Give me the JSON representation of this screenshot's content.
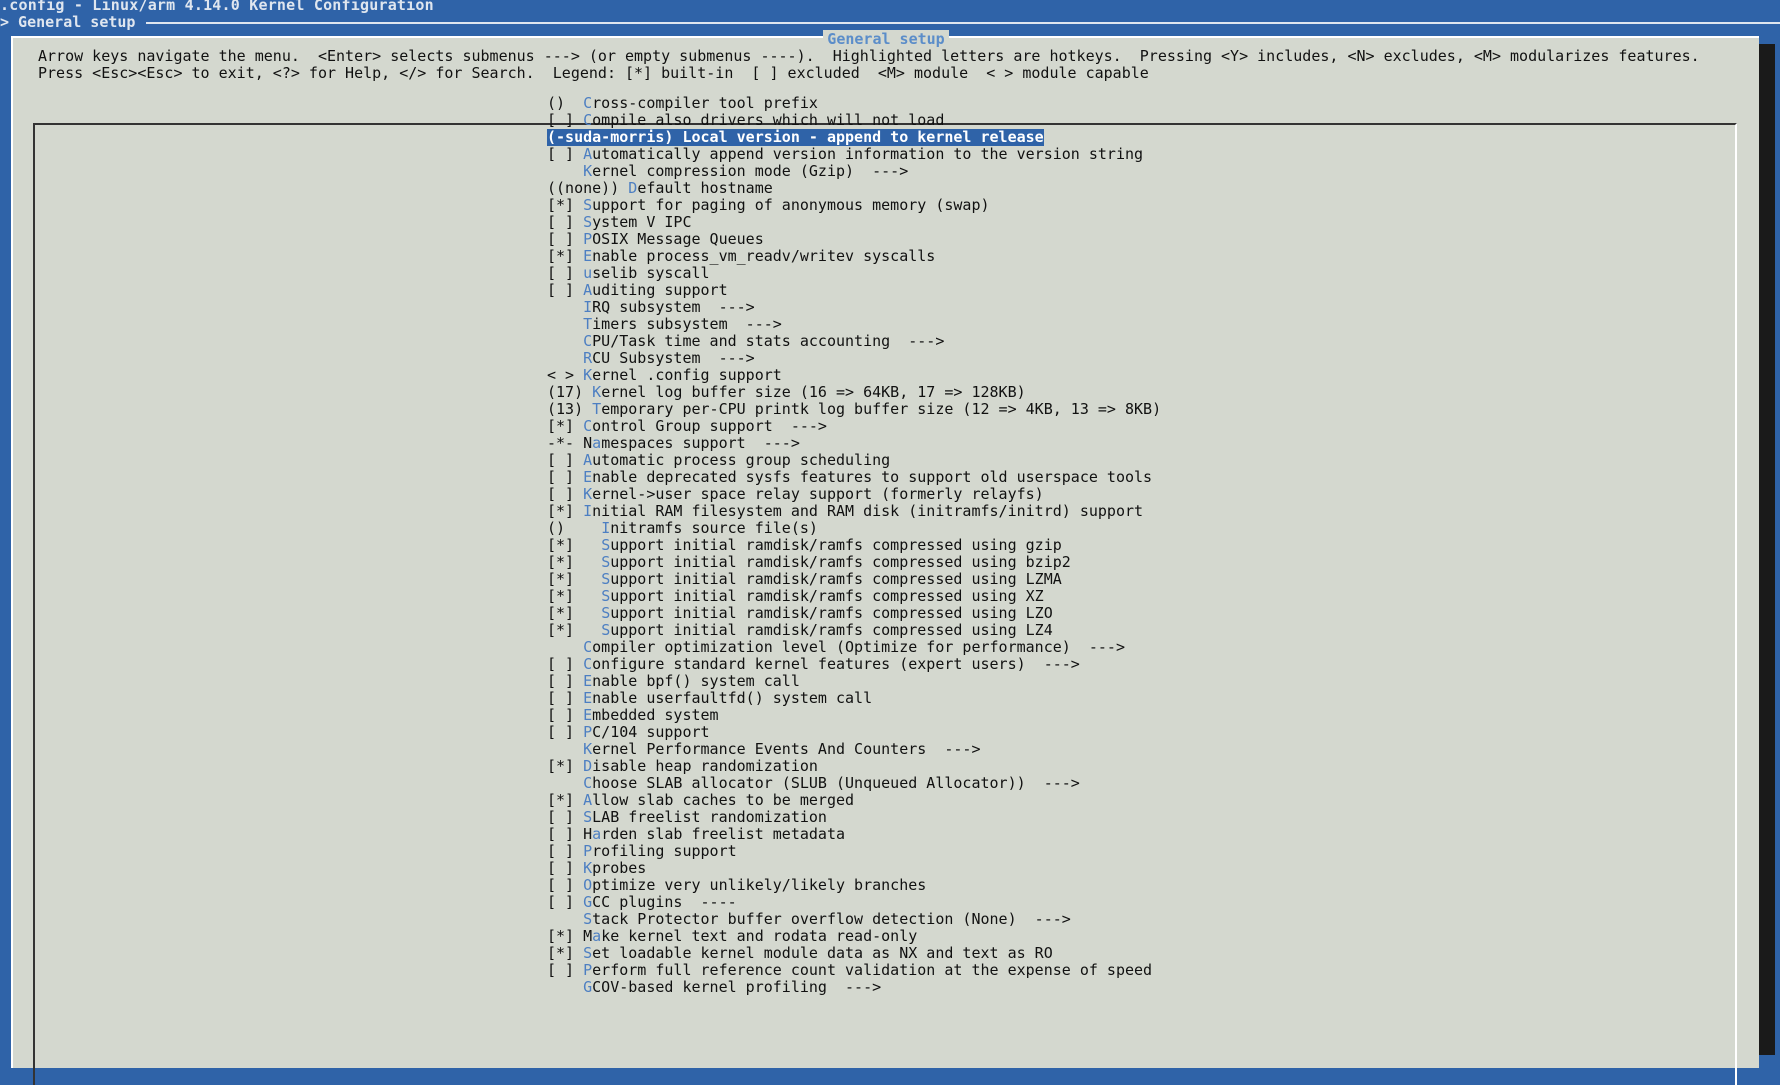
{
  "window": {
    "title": ".config - Linux/arm 4.14.0 Kernel Configuration",
    "breadcrumb": "> General setup"
  },
  "colors": {
    "background": "#2f63a8",
    "dialog": "#d4d8cf",
    "hotkey": "#4d7fc2",
    "selection": "#2f63a8"
  },
  "dialog": {
    "title": "General setup",
    "help_line1": "Arrow keys navigate the menu.  <Enter> selects submenus ---> (or empty submenus ----).  Highlighted letters are hotkeys.  Pressing <Y> includes, <N> excludes, <M> modularizes features.",
    "help_line2": "Press <Esc><Esc> to exit, <?> for Help, </> for Search.  Legend: [*] built-in  [ ] excluded  <M> module  < > module capable"
  },
  "menu": {
    "selected_index": 2,
    "items": [
      {
        "mark": "()  ",
        "hk": "C",
        "rest": "ross-compiler tool prefix"
      },
      {
        "mark": "[ ] ",
        "hk": "C",
        "rest": "ompile also drivers which will not load"
      },
      {
        "mark": "(-suda-morris) ",
        "hk": "L",
        "rest": "ocal version - append to kernel release"
      },
      {
        "mark": "[ ] ",
        "hk": "A",
        "rest": "utomatically append version information to the version string"
      },
      {
        "mark": "    ",
        "hk": "K",
        "rest": "ernel compression mode (Gzip)  --->"
      },
      {
        "mark": "((none)) ",
        "hk": "D",
        "rest": "efault hostname"
      },
      {
        "mark": "[*] ",
        "hk": "S",
        "rest": "upport for paging of anonymous memory (swap)"
      },
      {
        "mark": "[ ] ",
        "hk": "S",
        "rest": "ystem V IPC"
      },
      {
        "mark": "[ ] ",
        "hk": "P",
        "rest": "OSIX Message Queues"
      },
      {
        "mark": "[*] ",
        "hk": "E",
        "rest": "nable process_vm_readv/writev syscalls"
      },
      {
        "mark": "[ ] ",
        "hk": "u",
        "rest": "selib syscall"
      },
      {
        "mark": "[ ] ",
        "hk": "A",
        "rest": "uditing support"
      },
      {
        "mark": "    ",
        "hk": "I",
        "rest": "RQ subsystem  --->"
      },
      {
        "mark": "    ",
        "hk": "T",
        "rest": "imers subsystem  --->"
      },
      {
        "mark": "    ",
        "hk": "C",
        "rest": "PU/Task time and stats accounting  --->"
      },
      {
        "mark": "    ",
        "hk": "R",
        "rest": "CU Subsystem  --->"
      },
      {
        "mark": "< > ",
        "hk": "K",
        "rest": "ernel .config support"
      },
      {
        "mark": "(17) ",
        "hk": "K",
        "rest": "ernel log buffer size (16 => 64KB, 17 => 128KB)"
      },
      {
        "mark": "(13) ",
        "hk": "T",
        "rest": "emporary per-CPU printk log buffer size (12 => 4KB, 13 => 8KB)"
      },
      {
        "mark": "[*] ",
        "hk": "C",
        "rest": "ontrol Group support  --->"
      },
      {
        "mark": "-*- N",
        "hk": "a",
        "rest": "mespaces support  --->"
      },
      {
        "mark": "[ ] ",
        "hk": "A",
        "rest": "utomatic process group scheduling"
      },
      {
        "mark": "[ ] ",
        "hk": "E",
        "rest": "nable deprecated sysfs features to support old userspace tools"
      },
      {
        "mark": "[ ] ",
        "hk": "K",
        "rest": "ernel->user space relay support (formerly relayfs)"
      },
      {
        "mark": "[*] ",
        "hk": "I",
        "rest": "nitial RAM filesystem and RAM disk (initramfs/initrd) support"
      },
      {
        "mark": "()    ",
        "hk": "I",
        "rest": "nitramfs source file(s)"
      },
      {
        "mark": "[*]   ",
        "hk": "S",
        "rest": "upport initial ramdisk/ramfs compressed using gzip"
      },
      {
        "mark": "[*]   ",
        "hk": "S",
        "rest": "upport initial ramdisk/ramfs compressed using bzip2"
      },
      {
        "mark": "[*]   ",
        "hk": "S",
        "rest": "upport initial ramdisk/ramfs compressed using LZMA"
      },
      {
        "mark": "[*]   ",
        "hk": "S",
        "rest": "upport initial ramdisk/ramfs compressed using XZ"
      },
      {
        "mark": "[*]   ",
        "hk": "S",
        "rest": "upport initial ramdisk/ramfs compressed using LZO"
      },
      {
        "mark": "[*]   ",
        "hk": "S",
        "rest": "upport initial ramdisk/ramfs compressed using LZ4"
      },
      {
        "mark": "    ",
        "hk": "C",
        "rest": "ompiler optimization level (Optimize for performance)  --->"
      },
      {
        "mark": "[ ] ",
        "hk": "C",
        "rest": "onfigure standard kernel features (expert users)  --->"
      },
      {
        "mark": "[ ] ",
        "hk": "E",
        "rest": "nable bpf() system call"
      },
      {
        "mark": "[ ] ",
        "hk": "E",
        "rest": "nable userfaultfd() system call"
      },
      {
        "mark": "[ ] ",
        "hk": "E",
        "rest": "mbedded system"
      },
      {
        "mark": "[ ] ",
        "hk": "P",
        "rest": "C/104 support"
      },
      {
        "mark": "    ",
        "hk": "K",
        "rest": "ernel Performance Events And Counters  --->"
      },
      {
        "mark": "[*] ",
        "hk": "D",
        "rest": "isable heap randomization"
      },
      {
        "mark": "    ",
        "hk": "C",
        "rest": "hoose SLAB allocator (SLUB (Unqueued Allocator))  --->"
      },
      {
        "mark": "[*] ",
        "hk": "A",
        "rest": "llow slab caches to be merged"
      },
      {
        "mark": "[ ] ",
        "hk": "S",
        "rest": "LAB freelist randomization"
      },
      {
        "mark": "[ ] H",
        "hk": "a",
        "rest": "rden slab freelist metadata"
      },
      {
        "mark": "[ ] ",
        "hk": "P",
        "rest": "rofiling support"
      },
      {
        "mark": "[ ] ",
        "hk": "K",
        "rest": "probes"
      },
      {
        "mark": "[ ] ",
        "hk": "O",
        "rest": "ptimize very unlikely/likely branches"
      },
      {
        "mark": "[ ] ",
        "hk": "G",
        "rest": "CC plugins  ----"
      },
      {
        "mark": "    ",
        "hk": "S",
        "rest": "tack Protector buffer overflow detection (None)  --->"
      },
      {
        "mark": "[*] M",
        "hk": "a",
        "rest": "ke kernel text and rodata read-only"
      },
      {
        "mark": "[*] ",
        "hk": "S",
        "rest": "et loadable kernel module data as NX and text as RO"
      },
      {
        "mark": "[ ] ",
        "hk": "P",
        "rest": "erform full reference count validation at the expense of speed"
      },
      {
        "mark": "    ",
        "hk": "G",
        "rest": "COV-based kernel profiling  --->"
      }
    ]
  }
}
